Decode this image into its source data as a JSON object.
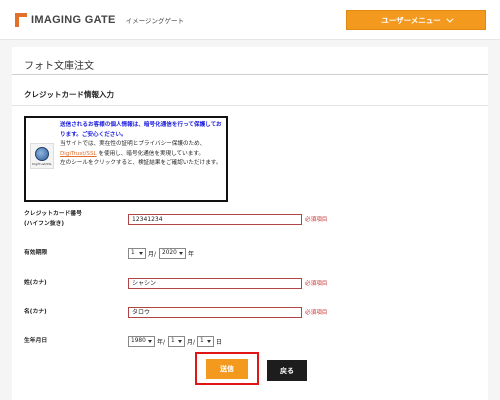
{
  "header": {
    "logo_text": "IMAGING GATE",
    "logo_sub": "イメージングゲート",
    "user_menu_label": "ユーザーメニュー"
  },
  "page": {
    "title": "フォト文庫注文",
    "section_title": "クレジットカード情報入力"
  },
  "notice": {
    "line_bold": "送信されるお客様の個人情報は、暗号化通信を行って保護しております。ご安心ください。",
    "line1": "当サイトでは、実在性の証明とプライバシー保護のため、",
    "link": "DigiTrust/SSL",
    "line2": "を使用し、暗号化通信を実現しています。",
    "line3": "左のシールをクリックすると、検証結果をご確認いただけます。",
    "seal_text": "DigiTrust/SSL"
  },
  "form": {
    "card_number_label": "クレジットカード番号",
    "card_number_sub": "(ハイフン抜き)",
    "card_number_value": "12341234",
    "expiry_label": "有効期限",
    "expiry_month": "1",
    "expiry_month_unit": "月/",
    "expiry_year": "2020",
    "expiry_year_unit": "年",
    "last_name_label": "姓(カナ)",
    "last_name_value": "シャシン",
    "first_name_label": "名(カナ)",
    "first_name_value": "タロウ",
    "birth_label": "生年月日",
    "birth_year": "1980",
    "birth_year_unit": "年/",
    "birth_month": "1",
    "birth_month_unit": "月/",
    "birth_day": "1",
    "birth_day_unit": "日",
    "required": "必須項目"
  },
  "buttons": {
    "submit": "送信",
    "back": "戻る"
  },
  "colors": {
    "accent": "#f39a1e",
    "logo": "#e0702a",
    "required": "#c83030",
    "highlight": "#e01515"
  }
}
